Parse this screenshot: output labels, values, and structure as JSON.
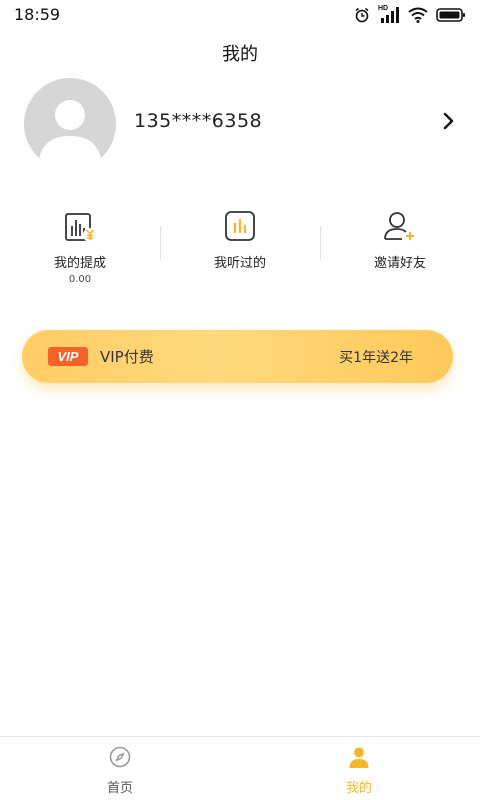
{
  "status_bar": {
    "time": "18:59",
    "network_label": "HD"
  },
  "header": {
    "title": "我的"
  },
  "profile": {
    "phone": "135****6358"
  },
  "stats": [
    {
      "label": "我的提成",
      "value": "0.00",
      "icon": "withdraw-chart-icon"
    },
    {
      "label": "我听过的",
      "icon": "history-chart-icon"
    },
    {
      "label": "邀请好友",
      "icon": "add-friend-icon"
    }
  ],
  "vip": {
    "badge": "VIP",
    "label": "VIP付费",
    "promo": "买1年送2年"
  },
  "nav": [
    {
      "label": "首页",
      "icon": "compass-icon",
      "active": false
    },
    {
      "label": "我的",
      "icon": "person-icon",
      "active": true
    }
  ],
  "colors": {
    "accent": "#f6b62a",
    "vip_badge": "#f5622a",
    "banner_start": "#ffcd64",
    "banner_end": "#ffc95a"
  }
}
